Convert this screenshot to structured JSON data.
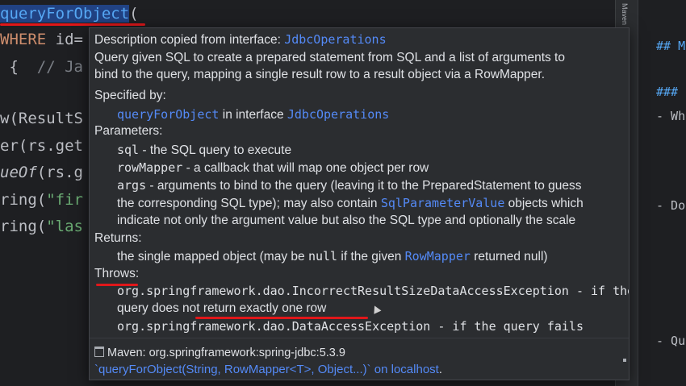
{
  "editor": {
    "line1_method": "queryForObject",
    "line1_paren": "(",
    "line2_kw": "WHERE",
    "line2_rest": " id=",
    "line3_brace": " {  ",
    "line3_comment": "// Ja",
    "line4": "w(ResultS",
    "line5": "er(rs.get",
    "line6_ital": "ueOf",
    "line6_rest": "(rs.g",
    "line7_pre": "ring(",
    "line7_str": "\"fir",
    "line8_pre": "ring(",
    "line8_str": "\"las"
  },
  "tool_strip": {
    "maven_tab": "Maven"
  },
  "right_pane": {
    "h2": "## M",
    "h3": "###",
    "item1": "- Wh",
    "item2": "- Do",
    "item3": "- Qu"
  },
  "doc": {
    "copied_prefix": "Description copied from interface: ",
    "copied_iface": "JdbcOperations",
    "desc1": "Query given SQL to create a prepared statement from SQL and a list of arguments to",
    "desc2": "bind to the query, mapping a single result row to a result object via a RowMapper.",
    "specified_by_label": "Specified by:",
    "spec_method": "queryForObject",
    "spec_in": " in interface ",
    "spec_iface": "JdbcOperations",
    "params_label": "Parameters:",
    "p_sql_name": "sql",
    "p_sql_desc": " - the SQL query to execute",
    "p_rm_name": "rowMapper",
    "p_rm_desc": " - a callback that will map one object per row",
    "p_args_name": "args",
    "p_args_desc": " - arguments to bind to the query (leaving it to the PreparedStatement to guess",
    "p_args_l2": "the corresponding SQL type); may also contain ",
    "p_args_link": "SqlParameterValue",
    "p_args_l2b": " objects which",
    "p_args_l3": "indicate not only the argument value but also the SQL type and optionally the scale",
    "returns_label": "Returns:",
    "ret_a": "the single mapped object (may be ",
    "ret_null": "null",
    "ret_b": " if the given ",
    "ret_link": "RowMapper",
    "ret_c": " returned null)",
    "throws_label": "Throws:",
    "t1": "org.springframework.dao.IncorrectResultSizeDataAccessException - if the",
    "t2a": "query does ",
    "t2b": "not return exactly one row",
    "t3": "org.springframework.dao.DataAccessException - if the query fails",
    "maven_line": "Maven: org.springframework:spring-jdbc:5.3.9",
    "sig_link": "`queryForObject(String, RowMapper<T>, Object...)` on localhost",
    "sig_dot": "."
  },
  "colors": {
    "accent_link": "#548af7",
    "annotation_red": "#e0171a"
  }
}
